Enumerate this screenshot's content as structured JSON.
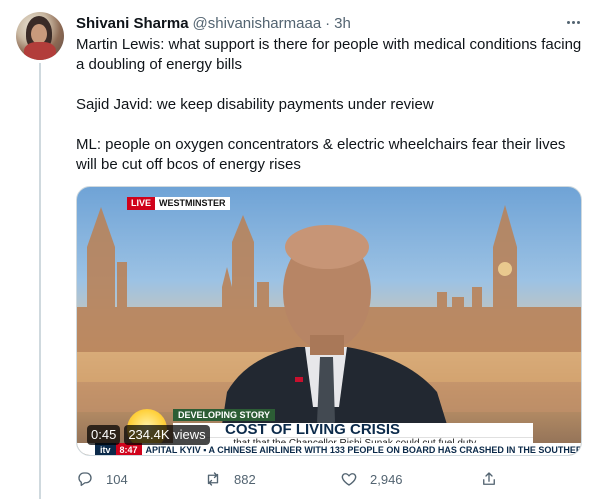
{
  "tweet": {
    "author_name": "Shivani Sharma",
    "handle": "@shivanisharmaaa",
    "separator": "·",
    "time": "3h",
    "text_lines": [
      "Martin Lewis: what support is there for people with medical conditions facing a doubling of energy bills",
      "Sajid Javid: we keep disability payments under review",
      "ML: people on oxygen concentrators & electric wheelchairs fear their lives will be cut off bcos of energy rises"
    ]
  },
  "media": {
    "live_label": "LIVE",
    "location": "WESTMINSTER",
    "developing": "DEVELOPING STORY",
    "headline": "COST OF LIVING CRISIS",
    "subheadline": "...that that the Chancellor Rishi Sunak could cut fuel duty",
    "ticker_brand": "itv",
    "ticker_time": "8:47",
    "ticker_text": "APITAL KYIV   ▪ A CHINESE AIRLINER WITH 133 PEOPLE ON BOARD HAS CRASHED IN THE SOUTHERN",
    "duration": "0:45",
    "views": "234.4K views"
  },
  "actions": {
    "reply_count": "104",
    "retweet_count": "882",
    "like_count": "2,946"
  },
  "icons": {
    "reply": "reply-icon",
    "retweet": "retweet-icon",
    "like": "heart-icon",
    "share": "share-icon",
    "more": "more-icon"
  },
  "colors": {
    "secondary_text": "#536471",
    "live_red": "#d0021b",
    "developing_green": "#2c5d35"
  }
}
